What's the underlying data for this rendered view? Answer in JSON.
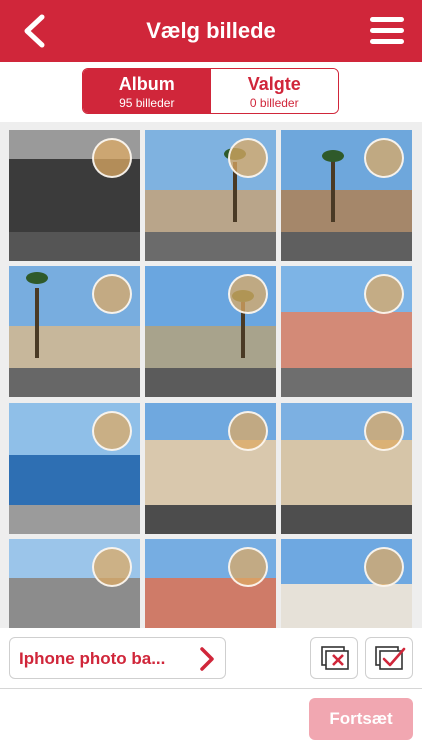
{
  "header": {
    "title": "Vælg billede",
    "back_icon": "chevron-left-icon",
    "menu_icon": "hamburger-menu-icon"
  },
  "tabs": [
    {
      "label": "Album",
      "sub": "95 billeder",
      "active": true
    },
    {
      "label": "Valgte",
      "sub": "0 billeder",
      "active": false
    }
  ],
  "grid": {
    "columns": 3,
    "photo_count_visible": 12
  },
  "footer": {
    "album_label": "Iphone photo ba...",
    "deselect_all_icon": "deselect-all-icon",
    "select_all_icon": "select-all-icon",
    "continue_label": "Fortsæt",
    "continue_enabled": false
  },
  "colors": {
    "accent": "#d0263a",
    "disabled": "#f1a7b1"
  }
}
